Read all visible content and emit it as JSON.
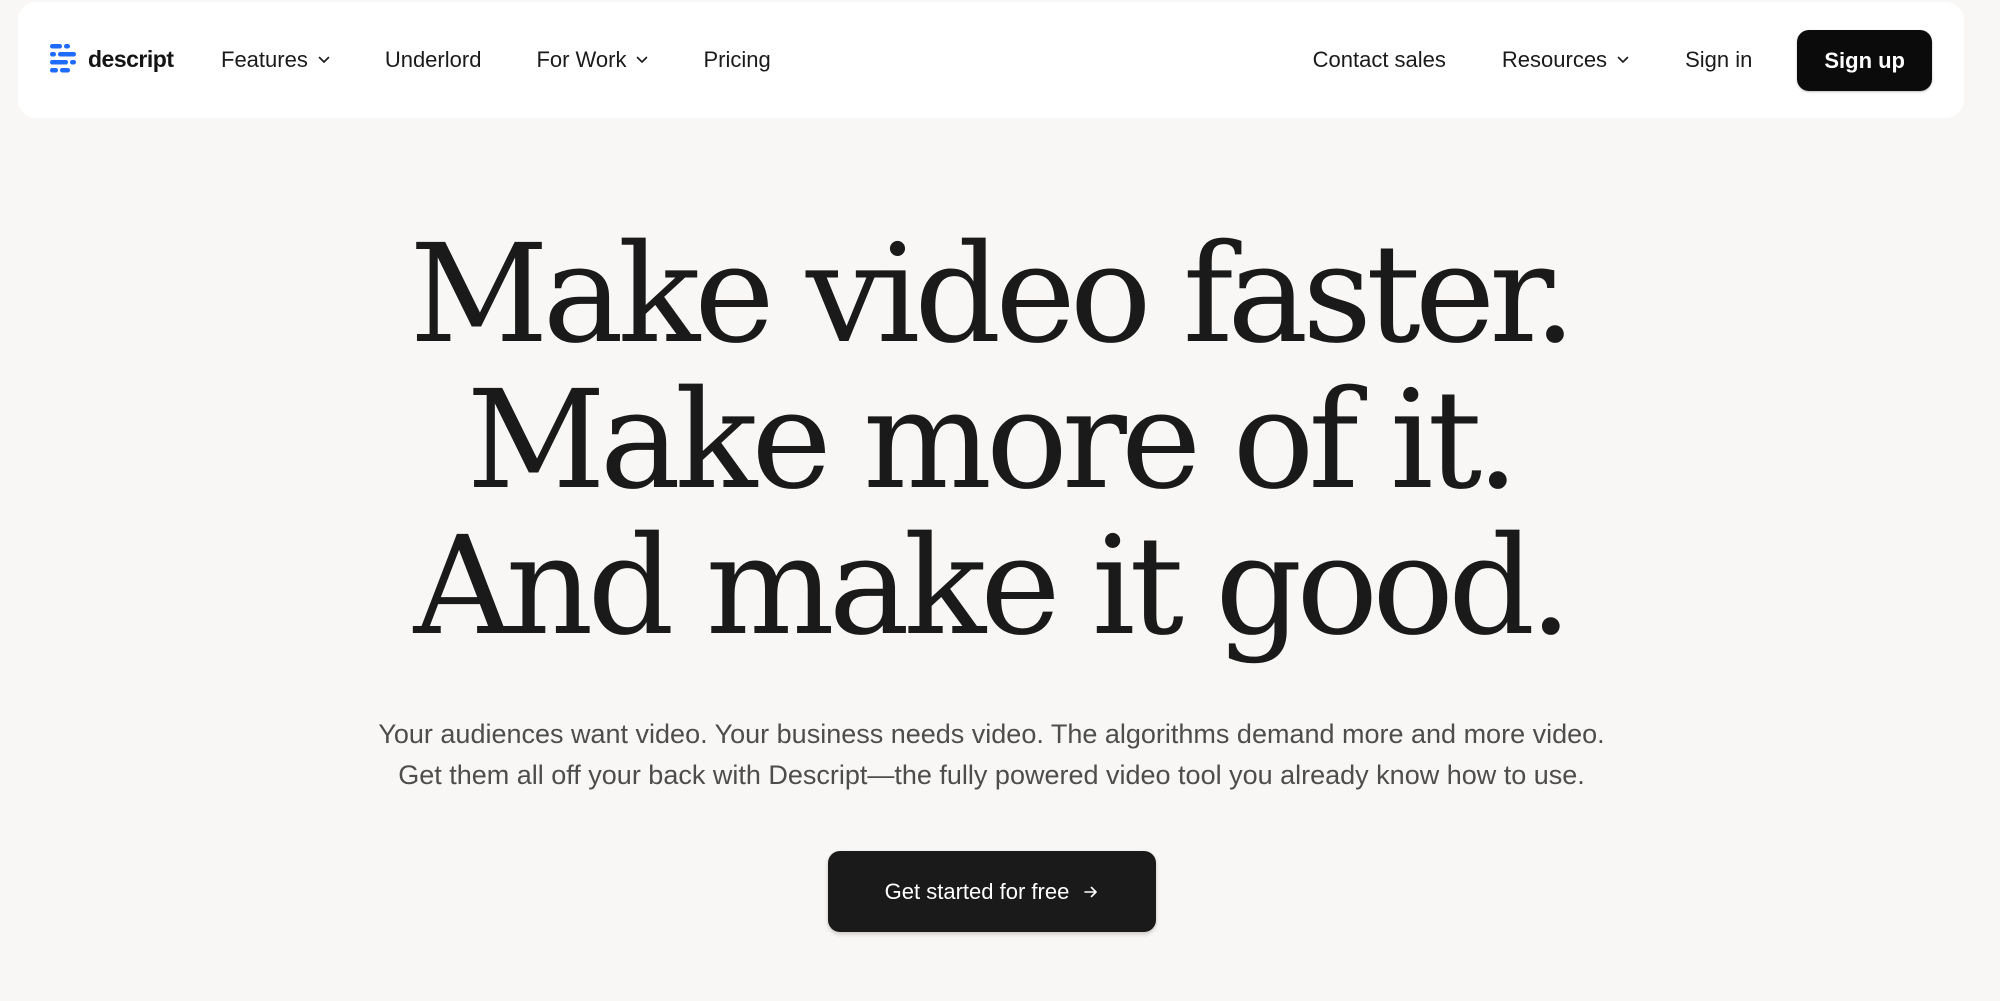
{
  "brand": {
    "name": "descript",
    "logo_icon": "descript-logo-icon",
    "accent_color": "#1f6bff"
  },
  "nav": {
    "left": [
      {
        "label": "Features",
        "has_dropdown": true
      },
      {
        "label": "Underlord",
        "has_dropdown": false
      },
      {
        "label": "For Work",
        "has_dropdown": true
      },
      {
        "label": "Pricing",
        "has_dropdown": false
      }
    ],
    "right": [
      {
        "label": "Contact sales",
        "has_dropdown": false
      },
      {
        "label": "Resources",
        "has_dropdown": true
      },
      {
        "label": "Sign in",
        "has_dropdown": false
      }
    ],
    "signup_label": "Sign up"
  },
  "hero": {
    "headline_lines": [
      "Make video faster.",
      "Make more of it.",
      "And make it good."
    ],
    "subtext_lines": [
      "Your audiences want video. Your business needs video. The algorithms demand more and more video.",
      "Get them all off your back with Descript—the fully powered video tool you already know how to use."
    ],
    "cta_label": "Get started for free",
    "cta_icon": "arrow-right-icon"
  }
}
